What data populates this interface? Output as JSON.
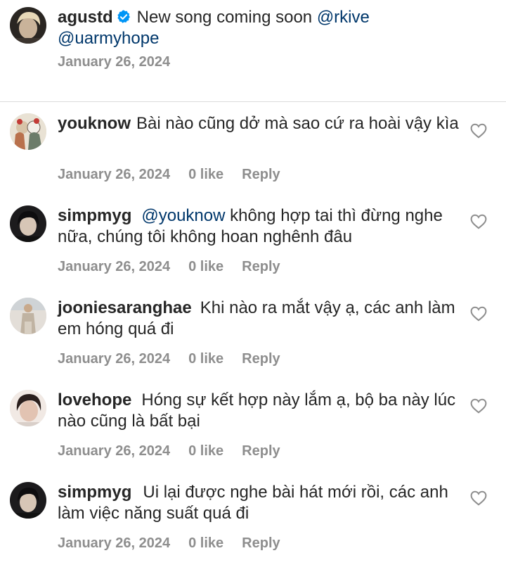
{
  "caption": {
    "username": "agustd",
    "text": "New song coming soon",
    "mention1": "@rkive",
    "mention2": "@uarmyhope",
    "date": "January 26, 2024"
  },
  "comments": [
    {
      "username": "youknow",
      "mention": "",
      "text": "Bài nào cũng dở mà sao cứ ra hoài vậy kìa",
      "date": "January 26, 2024",
      "likes": "0 like",
      "reply": "Reply"
    },
    {
      "username": "simpmyg",
      "mention": "@youknow",
      "text": "không hợp tai thì đừng nghe nữa, chúng tôi không hoan nghênh đâu",
      "date": "January 26, 2024",
      "likes": "0 like",
      "reply": "Reply"
    },
    {
      "username": "jooniesaranghae",
      "mention": "",
      "text": "Khi nào ra mắt vậy ạ, các anh làm em hóng quá đi",
      "date": "January 26, 2024",
      "likes": "0 like",
      "reply": "Reply"
    },
    {
      "username": "lovehope",
      "mention": "",
      "text": "Hóng sự kết hợp này lắm ạ, bộ ba này lúc nào cũng là bất bại",
      "date": "January 26, 2024",
      "likes": "0 like",
      "reply": "Reply"
    },
    {
      "username": "simpmyg",
      "mention": "",
      "text": "Ui lại được nghe bài hát mới rồi, các anh làm việc năng suất quá đi",
      "date": "January 26, 2024",
      "likes": "0 like",
      "reply": "Reply"
    }
  ],
  "colors": {
    "mention": "#00376b",
    "meta": "#8e8e8e",
    "verified": "#0095f6"
  },
  "icons": {
    "verified": "verified-badge-icon",
    "like": "heart-outline-icon"
  }
}
